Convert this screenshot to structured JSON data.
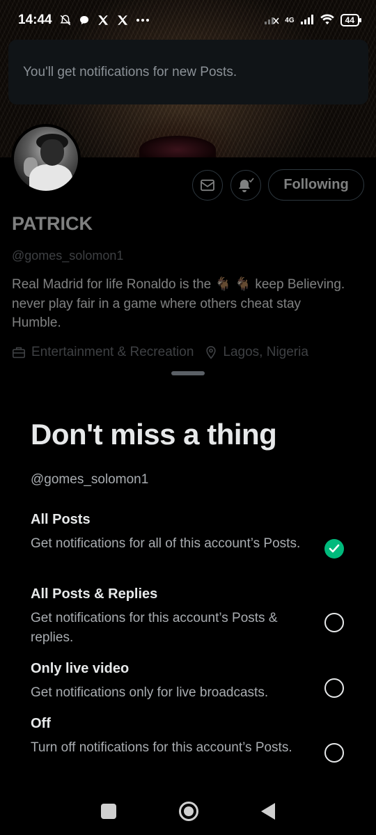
{
  "status_bar": {
    "time": "14:44",
    "battery": "44",
    "network": "4G"
  },
  "toast": {
    "message": "You'll get notifications for new Posts."
  },
  "profile": {
    "follow_button": "Following",
    "name": "PATRICK",
    "handle": "@gomes_solomon1",
    "bio": "Real Madrid for life Ronaldo is the 🐐 🐐 keep Believing. never play fair in a game where others cheat stay Humble.",
    "category": "Entertainment & Recreation",
    "location": "Lagos, Nigeria"
  },
  "sheet": {
    "title": "Don't miss a thing",
    "handle": "@gomes_solomon1",
    "options": [
      {
        "title": "All Posts",
        "description": "Get notifications for all of this account’s Posts.",
        "selected": true
      },
      {
        "title": "All Posts & Replies",
        "description": "Get notifications for this account’s Posts & replies.",
        "selected": false
      },
      {
        "title": "Only live video",
        "description": "Get notifications only for live broadcasts.",
        "selected": false
      },
      {
        "title": "Off",
        "description": "Turn off notifications for this account’s Posts.",
        "selected": false
      }
    ]
  },
  "colors": {
    "accent_check": "#00ba7c",
    "muted_text": "#71767b",
    "background": "#000000"
  },
  "icons": [
    "mute-bell-icon",
    "chat-icon",
    "x-logo-icon",
    "more-dots-icon",
    "signal-icon",
    "wifi-icon",
    "battery-icon",
    "mail-icon",
    "bell-check-icon",
    "briefcase-icon",
    "location-pin-icon",
    "check-icon",
    "nav-recents-icon",
    "nav-home-icon",
    "nav-back-icon"
  ]
}
